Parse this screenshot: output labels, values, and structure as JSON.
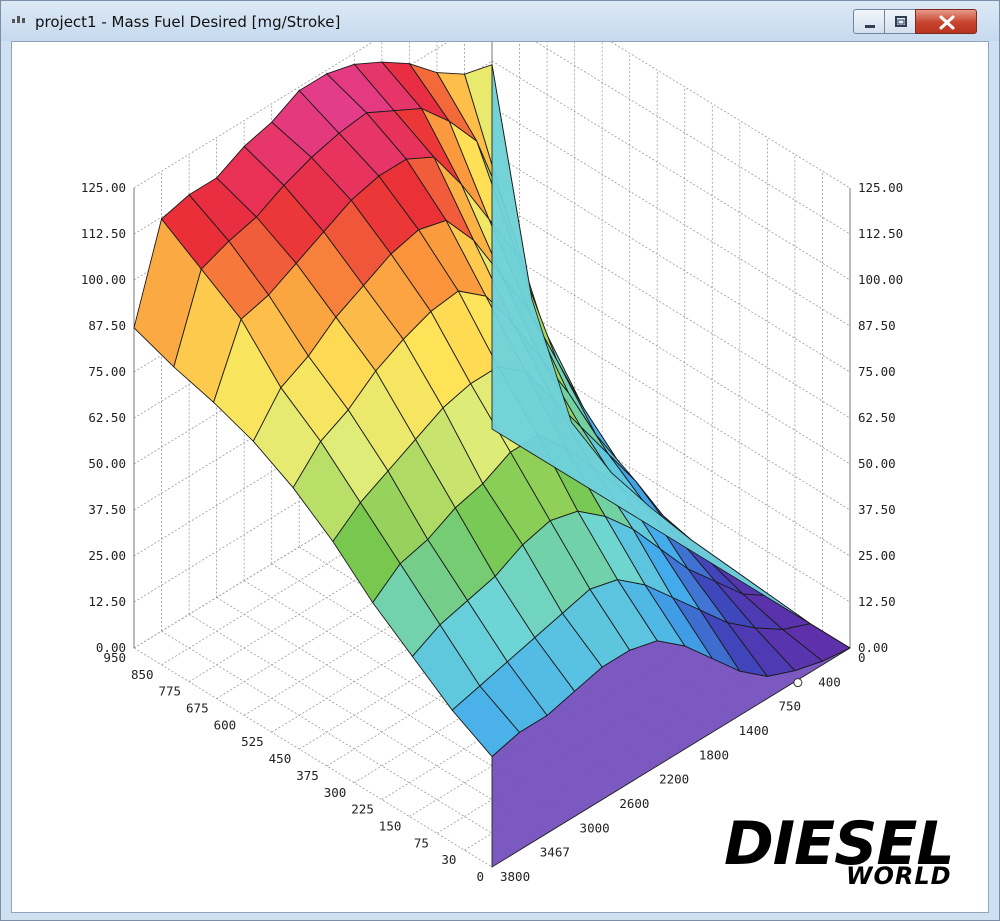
{
  "window": {
    "title": "project1 - Mass Fuel Desired [mg/Stroke]"
  },
  "chart_data": {
    "type": "surface3d",
    "title": "Mass Fuel Desired [mg/Stroke]",
    "zlim": [
      0,
      125
    ],
    "z_ticks": [
      "125.00",
      "112.50",
      "100.00",
      "87.50",
      "75.00",
      "62.50",
      "50.00",
      "37.50",
      "25.00",
      "12.50",
      "0.00"
    ],
    "x_axis_ticks": [
      "950",
      "850",
      "775",
      "675",
      "600",
      "525",
      "450",
      "375",
      "300",
      "225",
      "150",
      "75",
      "30",
      "0"
    ],
    "y_axis_ticks": [
      "0",
      "400",
      "750",
      "1400",
      "1800",
      "2200",
      "2600",
      "3000",
      "3467",
      "3800"
    ],
    "grid": true,
    "colormap": "rainbow",
    "surface_z": [
      [
        87,
        112,
        114,
        114,
        118,
        120,
        124,
        124,
        122,
        118,
        113,
        106,
        101,
        99
      ],
      [
        83,
        105,
        108,
        110,
        114,
        117,
        119,
        120,
        116,
        112,
        104,
        94,
        72,
        42
      ],
      [
        80,
        98,
        100,
        104,
        108,
        112,
        114,
        114,
        110,
        98,
        84,
        70,
        45,
        15
      ],
      [
        76,
        86,
        90,
        96,
        100,
        104,
        106,
        104,
        94,
        80,
        66,
        48,
        30,
        8
      ],
      [
        70,
        78,
        82,
        88,
        92,
        95,
        96,
        90,
        78,
        64,
        50,
        34,
        20,
        5
      ],
      [
        62,
        68,
        72,
        76,
        80,
        82,
        82,
        76,
        64,
        52,
        40,
        28,
        14,
        3
      ],
      [
        52,
        58,
        60,
        64,
        66,
        70,
        70,
        62,
        52,
        42,
        32,
        20,
        10,
        2
      ],
      [
        44,
        48,
        50,
        52,
        56,
        58,
        56,
        50,
        42,
        32,
        22,
        14,
        6,
        1
      ],
      [
        36,
        38,
        40,
        42,
        44,
        46,
        44,
        38,
        30,
        22,
        14,
        8,
        3,
        0
      ],
      [
        30,
        32,
        32,
        34,
        36,
        36,
        34,
        28,
        20,
        12,
        6,
        3,
        1,
        0
      ]
    ]
  },
  "logo": {
    "line1": "DIESEL",
    "line2": "WORLD"
  },
  "colors": {
    "titlebar": "#c6d9ee",
    "close_button": "#c7432d"
  }
}
